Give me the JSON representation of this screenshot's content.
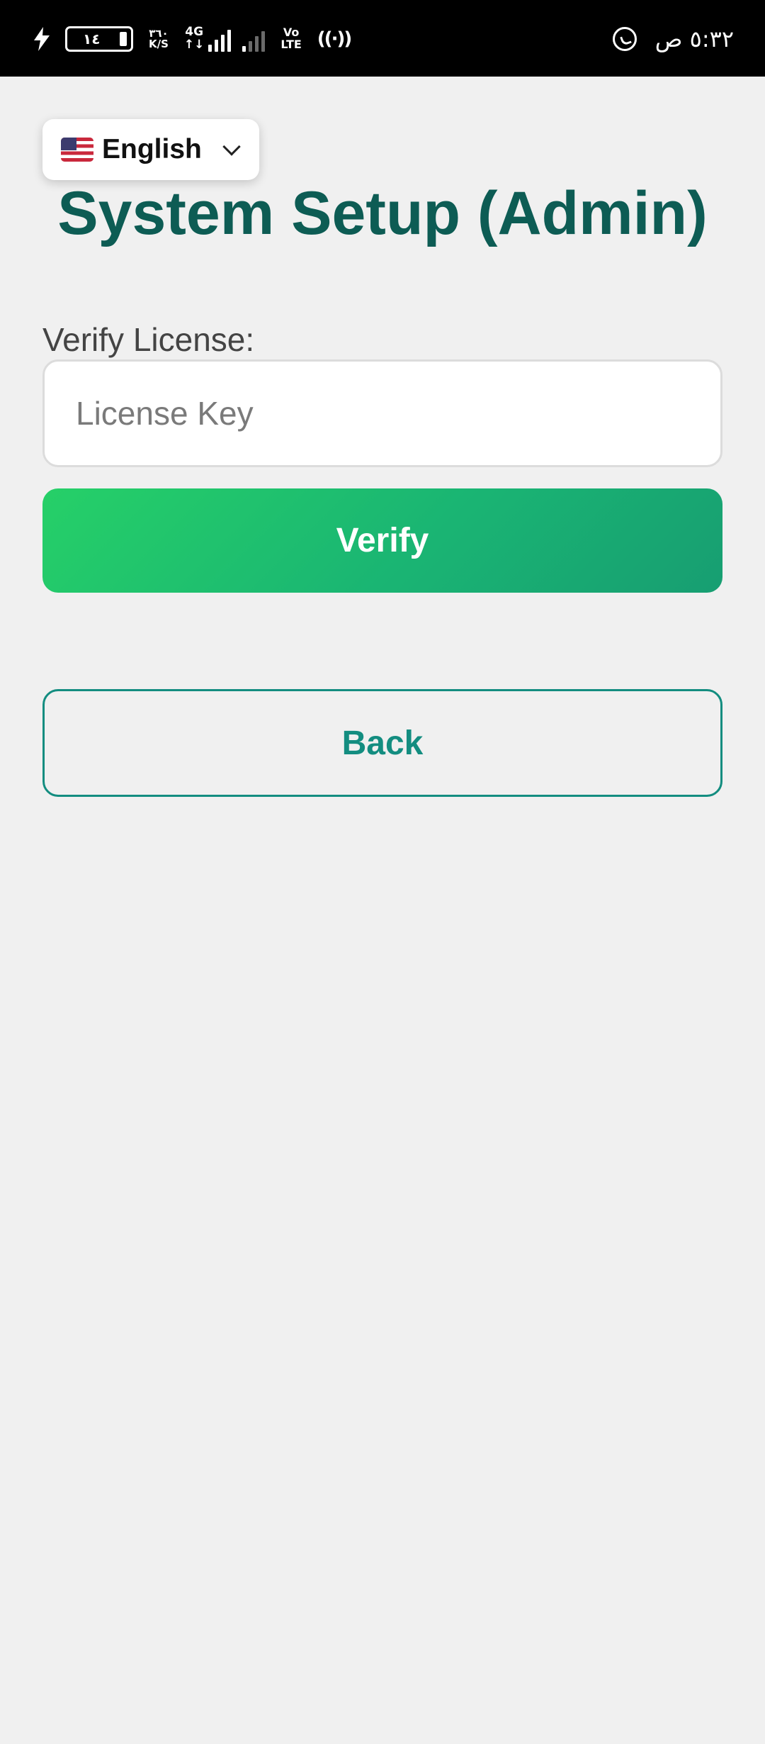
{
  "status_bar": {
    "battery_level": "١٤",
    "net_speed_value": "٣٦٠",
    "net_speed_unit": "K/S",
    "network_type": "4G",
    "network_arrows": "↑↓",
    "volte_top": "Vo",
    "volte_bottom": "LTE",
    "hotspot": "((·))",
    "time": "٥:٣٢ ص",
    "icons": [
      "charging-bolt-icon",
      "battery-icon",
      "signal-icon",
      "hotspot-icon",
      "whatsapp-icon"
    ]
  },
  "language_selector": {
    "flag": "us-flag-icon",
    "label": "English"
  },
  "header": {
    "title": "System Setup (Admin)"
  },
  "form": {
    "license_label": "Verify License:",
    "license_input": {
      "value": "",
      "placeholder": "License Key"
    },
    "verify_label": "Verify",
    "back_label": "Back"
  },
  "colors": {
    "title": "#0d5c54",
    "accent": "#138d80",
    "button_gradient_start": "#26d068",
    "button_gradient_end": "#179e72",
    "background": "#f0f0f0"
  }
}
